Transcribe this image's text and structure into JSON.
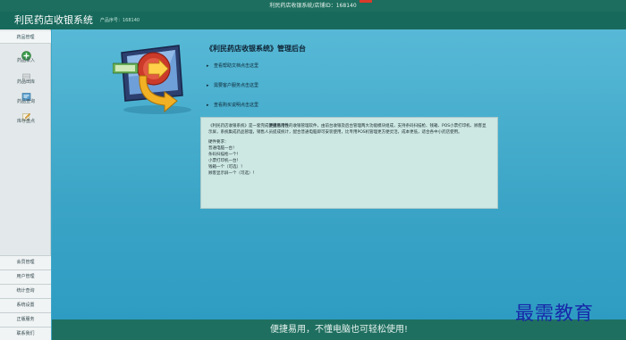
{
  "topbar": {
    "title": "利民药店收银系统/店铺ID：168140"
  },
  "header": {
    "app_title": "利民药店收银系统",
    "product_id": "产品序号：168140"
  },
  "sidebar": {
    "section_label": "药品管理",
    "buttons": [
      {
        "label": "药品录入",
        "icon": "add-icon"
      },
      {
        "label": "药品出库",
        "icon": "box-icon"
      },
      {
        "label": "药品查询",
        "icon": "search-list-icon"
      },
      {
        "label": "库存盘点",
        "icon": "edit-icon"
      }
    ],
    "bottom_items": [
      "会员管理",
      "用户管理",
      "统计查询",
      "系统设置",
      "正版服务",
      "联系我们"
    ]
  },
  "main": {
    "title": "《利民药店收银系统》管理后台",
    "links": [
      "查看帮助文档点击这里",
      "需要客户服务点击这里",
      "查看购买说明点击这里"
    ],
    "info": {
      "paragraph_start": "《利民药店收银系统》是一套完成",
      "paragraph_bold": "便捷易用性",
      "paragraph_end": "的收银管理软件，由前台收银及后台管理两大功能模块组成，支持条码扫描枪、钱箱、POS小票打印机、顾客显示屏，系统集成药品管理，销售人员提成统计，配合普通电脑即可安装使用，比专用POS机管理更方便灵活，成本更低，适合各中小药店使用。",
      "requirements_title": "硬件要求：",
      "requirements": [
        "普通电脑一台！",
        "条码扫描枪一个！",
        "小票打印机一台！",
        "钱箱一个（可选）！",
        "顾客显示屏一个（可选）！"
      ]
    }
  },
  "bottom_bar": {
    "slogan": "便捷易用，不懂电脑也可轻松使用!"
  },
  "watermark": {
    "text": "最需教育"
  },
  "colors": {
    "header": "#17695b",
    "background": "#3fa7c8",
    "info_box": "#cde7e3",
    "watermark": "#1727a8"
  }
}
